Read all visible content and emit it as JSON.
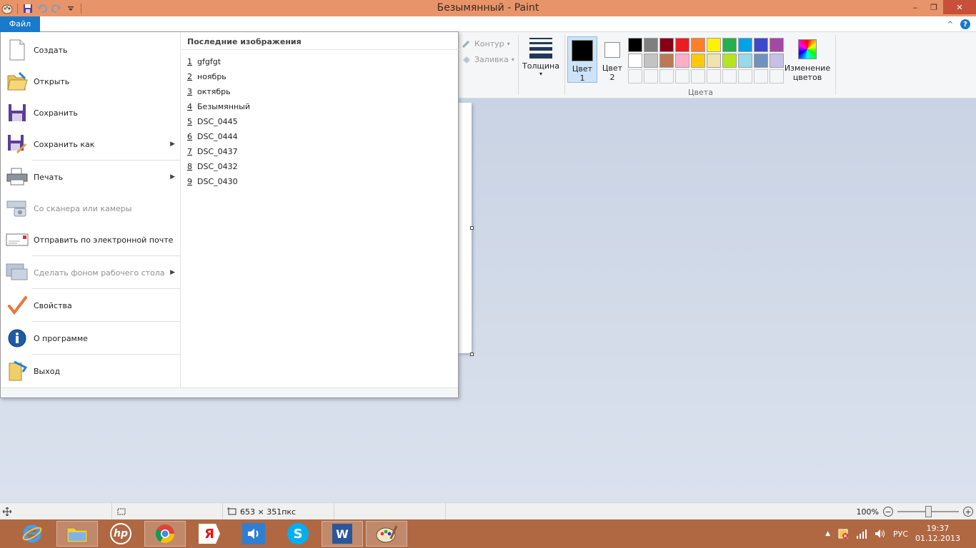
{
  "window": {
    "title": "Безымянный - Paint",
    "controls": {
      "minimize": "‒",
      "maximize": "❐",
      "close": "✕"
    }
  },
  "quick_access": {
    "icons": [
      "paint-app-icon",
      "save-icon",
      "undo-icon",
      "redo-icon",
      "customize-dropdown-icon"
    ]
  },
  "ribbon": {
    "file_tab": "Файл",
    "help_glyph": "?",
    "collapse_glyph": "^",
    "outline_label": "Контур",
    "fill_label": "Заливка",
    "thickness_label": "Толщина",
    "color1_label_line1": "Цвет",
    "color1_label_line2": "1",
    "color2_label_line1": "Цвет",
    "color2_label_line2": "2",
    "color1_value": "#000000",
    "color2_value": "#ffffff",
    "edit_colors_line1": "Изменение",
    "edit_colors_line2": "цветов",
    "colors_group_label": "Цвета",
    "palette_row1": [
      "#000000",
      "#7f7f7f",
      "#880015",
      "#ed1c24",
      "#ff7f27",
      "#fff200",
      "#22b14c",
      "#00a2e8",
      "#3f48cc",
      "#a349a4"
    ],
    "palette_row2": [
      "#ffffff",
      "#c3c3c3",
      "#b97a57",
      "#ffaec9",
      "#ffc90e",
      "#efe4b0",
      "#b5e61d",
      "#99d9ea",
      "#7092be",
      "#c8bfe7"
    ]
  },
  "file_menu": {
    "items": [
      {
        "label": "Создать",
        "icon": "new-document-icon",
        "disabled": false,
        "submenu": false
      },
      {
        "label": "Открыть",
        "icon": "open-folder-icon",
        "disabled": false,
        "submenu": false
      },
      {
        "label": "Сохранить",
        "icon": "save-icon",
        "disabled": false,
        "submenu": false
      },
      {
        "label": "Сохранить как",
        "icon": "save-as-icon",
        "disabled": false,
        "submenu": true
      },
      {
        "label": "Печать",
        "icon": "printer-icon",
        "disabled": false,
        "submenu": true
      },
      {
        "label": "Со сканера или камеры",
        "icon": "scanner-camera-icon",
        "disabled": true,
        "submenu": false
      },
      {
        "label": "Отправить по электронной почте",
        "icon": "email-icon",
        "disabled": false,
        "submenu": false
      },
      {
        "label": "Сделать фоном рабочего стола",
        "icon": "desktop-background-icon",
        "disabled": true,
        "submenu": true
      },
      {
        "label": "Свойства",
        "icon": "checkmark-icon",
        "disabled": false,
        "submenu": false
      },
      {
        "label": "О программе",
        "icon": "info-icon",
        "disabled": false,
        "submenu": false
      },
      {
        "label": "Выход",
        "icon": "exit-icon",
        "disabled": false,
        "submenu": false
      }
    ],
    "recent_title": "Последние изображения",
    "recent": [
      {
        "num": "1",
        "name": "gfgfgt"
      },
      {
        "num": "2",
        "name": "ноябрь"
      },
      {
        "num": "3",
        "name": "октябрь"
      },
      {
        "num": "4",
        "name": "Безымянный"
      },
      {
        "num": "5",
        "name": "DSC_0445"
      },
      {
        "num": "6",
        "name": "DSC_0444"
      },
      {
        "num": "7",
        "name": "DSC_0437"
      },
      {
        "num": "8",
        "name": "DSC_0432"
      },
      {
        "num": "9",
        "name": "DSC_0430"
      }
    ]
  },
  "status_bar": {
    "image_size": "653 × 351пкс",
    "zoom": "100%",
    "zoom_fraction": 0.5
  },
  "taskbar": {
    "apps": [
      "ie-icon",
      "file-explorer-icon",
      "hp-icon",
      "chrome-icon",
      "yandex-icon",
      "audio-player-icon",
      "skype-icon",
      "word-icon",
      "paint-icon"
    ],
    "hp_text": "hp",
    "yandex_text": "Я",
    "skype_text": "S",
    "word_text": "W",
    "lang": "РУС",
    "time": "19:37",
    "date": "01.12.2013"
  }
}
